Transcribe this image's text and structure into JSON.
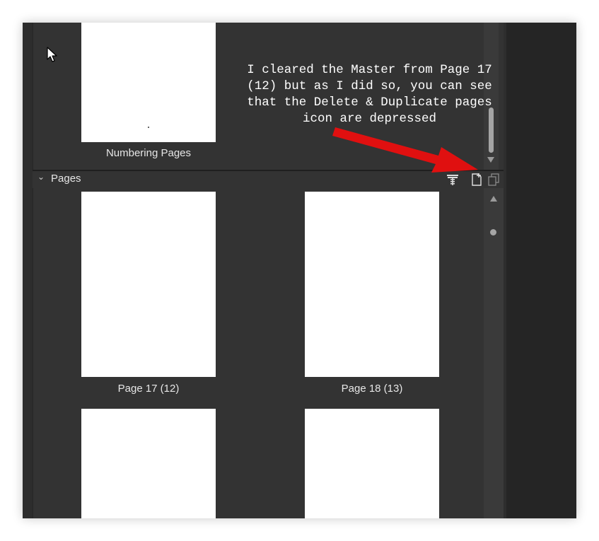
{
  "master": {
    "thumb_label": "Numbering Pages"
  },
  "pages_panel": {
    "title": "Pages",
    "buttons": {
      "master_icon": "apply-master-icon",
      "add_icon": "add-page-icon",
      "duplicate_icon": "duplicate-page-icon",
      "delete_icon": "delete-page-icon"
    },
    "items": [
      {
        "label": "Page 17 (12)"
      },
      {
        "label": "Page 18 (13)"
      },
      {
        "label": ""
      },
      {
        "label": ""
      }
    ]
  },
  "annotation": {
    "text": "I cleared the Master from Page 17\n(12) but as I did so, you can see\nthat the Delete & Duplicate pages\nicon are depressed",
    "arrow_color": "#e01010"
  },
  "colors": {
    "panel_bg": "#333333",
    "page_bg": "#ffffff",
    "text": "#e6e6e6"
  }
}
